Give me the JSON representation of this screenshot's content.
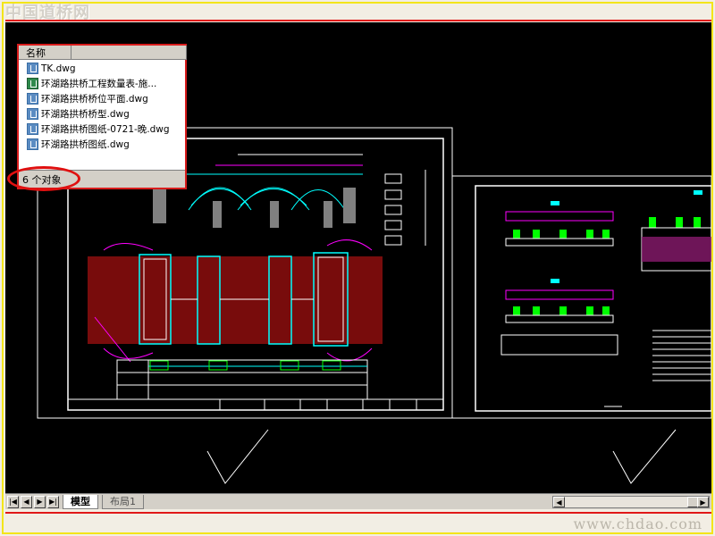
{
  "watermark": {
    "top": "中国道桥网",
    "bottom": "www.chdao.com"
  },
  "file_list": {
    "column_header": "名称",
    "files": [
      {
        "name": "TK.dwg",
        "icon": "dwg-file-icon"
      },
      {
        "name": "环湖路拱桥工程数量表-施...",
        "icon": "xls-file-icon"
      },
      {
        "name": "环湖路拱桥桥位平面.dwg",
        "icon": "dwg-file-icon"
      },
      {
        "name": "环湖路拱桥桥型.dwg",
        "icon": "dwg-file-icon"
      },
      {
        "name": "环湖路拱桥图纸-0721-晚.dwg",
        "icon": "dwg-file-icon"
      },
      {
        "name": "环湖路拱桥图纸.dwg",
        "icon": "dwg-file-icon"
      }
    ],
    "status": "6 个对象"
  },
  "tabs": {
    "nav_first": "|◀",
    "nav_prev": "◀",
    "nav_next": "▶",
    "nav_last": "▶|",
    "items": [
      {
        "label": "模型",
        "active": true
      },
      {
        "label": "布局1",
        "active": false
      }
    ]
  },
  "scrollbar": {
    "left_arrow": "◀",
    "right_arrow": "▶"
  },
  "colors": {
    "canvas": "#000000",
    "highlight_red": "#e01818",
    "frame_yellow": "#f3e51a",
    "cad_cyan": "#00ffff",
    "cad_magenta": "#ff00ff",
    "cad_green": "#00ff00"
  }
}
